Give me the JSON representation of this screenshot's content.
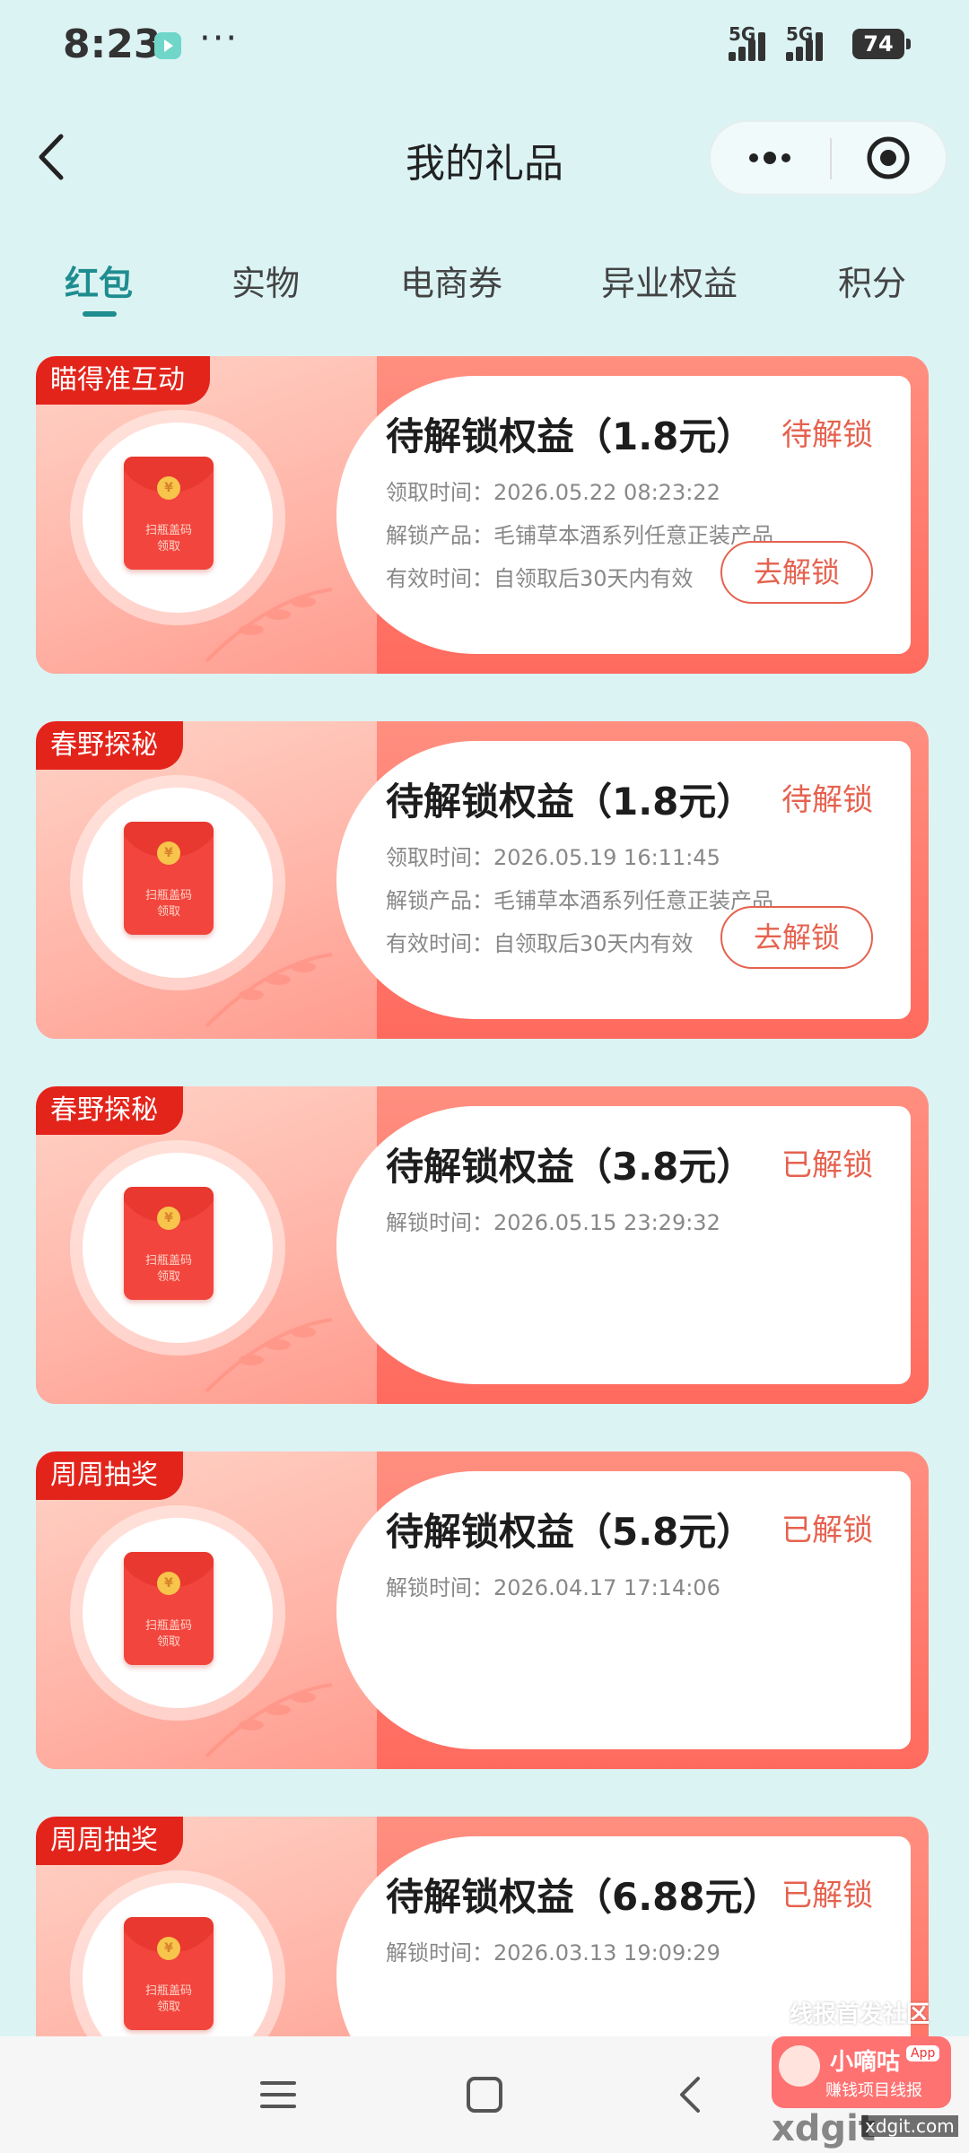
{
  "status_bar": {
    "time": "8:23",
    "dots": "···",
    "signal_1": "5G",
    "signal_2": "5G",
    "battery": "74"
  },
  "nav": {
    "title": "我的礼品"
  },
  "tabs": [
    {
      "label": "红包",
      "active": true
    },
    {
      "label": "实物",
      "active": false
    },
    {
      "label": "电商券",
      "active": false
    },
    {
      "label": "异业权益",
      "active": false
    },
    {
      "label": "积分",
      "active": false
    }
  ],
  "envelope_text": [
    "扫瓶盖码",
    "领取"
  ],
  "cards": [
    {
      "tag": "瞄得准互动",
      "title": "待解锁权益（1.8元）",
      "status": "待解锁",
      "lines": [
        {
          "label": "领取时间：",
          "value": "2026.05.22 08:23:22"
        },
        {
          "label": "解锁产品：",
          "value": "毛铺草本酒系列任意正装产品"
        },
        {
          "label": "有效时间：",
          "value": "自领取后30天内有效"
        }
      ],
      "button": "去解锁"
    },
    {
      "tag": "春野探秘",
      "title": "待解锁权益（1.8元）",
      "status": "待解锁",
      "lines": [
        {
          "label": "领取时间：",
          "value": "2026.05.19 16:11:45"
        },
        {
          "label": "解锁产品：",
          "value": "毛铺草本酒系列任意正装产品"
        },
        {
          "label": "有效时间：",
          "value": "自领取后30天内有效"
        }
      ],
      "button": "去解锁"
    },
    {
      "tag": "春野探秘",
      "title": "待解锁权益（3.8元）",
      "status": "已解锁",
      "lines": [
        {
          "label": "解锁时间：",
          "value": "2026.05.15 23:29:32"
        }
      ]
    },
    {
      "tag": "周周抽奖",
      "title": "待解锁权益（5.8元）",
      "status": "已解锁",
      "lines": [
        {
          "label": "解锁时间：",
          "value": "2026.04.17 17:14:06"
        }
      ]
    },
    {
      "tag": "周周抽奖",
      "title": "待解锁权益（6.88元）",
      "status": "已解锁",
      "lines": [
        {
          "label": "解锁时间：",
          "value": "2026.03.13 19:09:29"
        }
      ]
    }
  ],
  "watermark": {
    "community": "线报首发社区",
    "brand": "小嘀咕",
    "app": "App",
    "slogan": "赚钱项目线报",
    "url": "xdgit",
    "url_small": "xdgit.com"
  },
  "colors": {
    "background": "#dcf3f4",
    "accent": "#1f8d8f",
    "status_red": "#e5624f",
    "tag_red": "#e3241b"
  }
}
